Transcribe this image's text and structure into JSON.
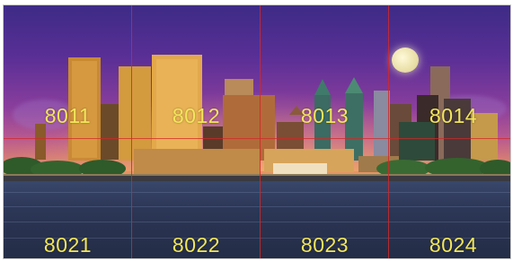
{
  "grid": {
    "line_color": "#d22828",
    "label_color": "#f2e65a",
    "rows": [
      {
        "tiles": [
          {
            "label": "8011"
          },
          {
            "label": "8012"
          },
          {
            "label": "8013"
          },
          {
            "label": "8014"
          }
        ]
      },
      {
        "tiles": [
          {
            "label": "8021"
          },
          {
            "label": "8022"
          },
          {
            "label": "8023"
          },
          {
            "label": "8024"
          }
        ]
      }
    ]
  },
  "image": {
    "subject": "city-skyline-at-dusk",
    "icons": [
      "moon-icon"
    ]
  }
}
